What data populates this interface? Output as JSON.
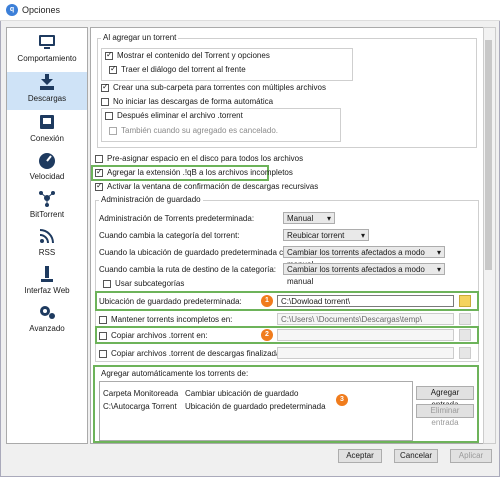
{
  "window": {
    "title": "Opciones",
    "app_icon": "qbittorrent-logo"
  },
  "sidebar": {
    "items": [
      {
        "label": "Comportamiento",
        "icon": "monitor-icon"
      },
      {
        "label": "Descargas",
        "icon": "download-icon",
        "selected": true
      },
      {
        "label": "Conexión",
        "icon": "network-icon"
      },
      {
        "label": "Velocidad",
        "icon": "speedometer-icon"
      },
      {
        "label": "BitTorrent",
        "icon": "bittorrent-icon"
      },
      {
        "label": "RSS",
        "icon": "rss-icon"
      },
      {
        "label": "Interfaz Web",
        "icon": "web-interface-icon"
      },
      {
        "label": "Avanzado",
        "icon": "advanced-gears-icon"
      }
    ]
  },
  "when_adding": {
    "title": "Al agregar un torrent",
    "show_contents": "Mostrar el contenido del Torrent y opciones",
    "bring_front": "Traer el diálogo del torrent al frente",
    "create_subfolder": "Crear una sub-carpeta para torrentes con múltiples archivos",
    "dont_start": "No iniciar las descargas de forma automática",
    "delete_after": "Después eliminar el archivo .torrent",
    "also_cancelled": "También cuando su agregado es cancelado."
  },
  "general": {
    "preallocate": "Pre-asignar espacio en el disco para todos los archivos",
    "append_ext": "Agregar la extensión .!qB a los archivos incompletos",
    "recursive_dialog": "Activar la ventana de confirmación de descargas recursivas"
  },
  "saving": {
    "title": "Administración de guardado",
    "mode_label": "Administración de Torrents predeterminada:",
    "mode_value": "Manual",
    "category_changed_label": "Cuando cambia la categoría del torrent:",
    "category_changed_value": "Reubicar torrent",
    "default_path_changed_label": "Cuando la ubicación de guardado predeterminada cambia:",
    "default_path_changed_value": "Cambiar los torrents afectados a modo manual",
    "category_path_changed_label": "Cuando cambia la ruta de destino de la categoría:",
    "category_path_changed_value": "Cambiar los torrents afectados a modo manual",
    "use_subcategories": "Usar subcategorías",
    "default_save_label": "Ubicación de guardado predeterminada:",
    "default_save_value": "C:\\Dowload torrent\\",
    "keep_incomplete_label": "Mantener torrents incompletos en:",
    "keep_incomplete_value": "C:\\Users\\            \\Documents\\Descargas\\temp\\",
    "copy_torrent_label": "Copiar archivos .torrent en:",
    "copy_torrent_value": "",
    "copy_finished_label": "Copiar archivos .torrent de descargas finalizadas a:",
    "copy_finished_value": ""
  },
  "autoadd": {
    "title": "Agregar automáticamente los torrents de:",
    "col_folder": "Carpeta Monitoreada",
    "col_action": "Cambiar ubicación de guardado",
    "row_folder": "C:\\Autocarga Torrent",
    "row_action": "Ubicación de guardado predeterminada",
    "add_button": "Agregar entrada",
    "remove_button": "Eliminar entrada"
  },
  "badges": [
    "1",
    "2",
    "3"
  ],
  "footer": {
    "accept": "Aceptar",
    "cancel": "Cancelar",
    "apply": "Aplicar"
  },
  "colors": {
    "highlight": "#6db35a",
    "badge": "#f07c1d",
    "selected_bg": "#cfe3f7"
  }
}
